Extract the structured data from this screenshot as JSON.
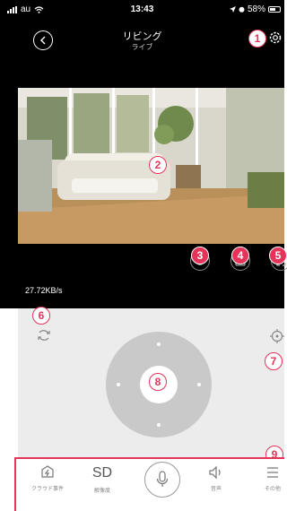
{
  "status_bar": {
    "carrier": "au",
    "time": "13:43",
    "battery": "58%"
  },
  "header": {
    "title": "リビング",
    "subtitle": "ライブ",
    "back_icon": "chevron-left-icon",
    "settings_icon": "gear-icon"
  },
  "video": {
    "data_rate": "27.72KB/s"
  },
  "video_controls": [
    {
      "icon": "replay-icon",
      "badge": "3"
    },
    {
      "icon": "camera-icon",
      "badge": "4"
    },
    {
      "icon": "fullscreen-icon",
      "badge": "5"
    }
  ],
  "control_panel": {
    "switch_icon": "switch-camera-icon",
    "locate_icon": "crosshair-icon"
  },
  "annotations": {
    "settings": "1",
    "video": "2",
    "replay": "3",
    "snapshot": "4",
    "fullscreen": "5",
    "switch": "6",
    "locate": "7",
    "joystick": "8",
    "tabbar": "9"
  },
  "tabbar": {
    "cloud_label": "クラウド事件",
    "sd_text": "SD",
    "sd_label": "解像度",
    "sound_label": "音声",
    "more_label": "その他"
  },
  "colors": {
    "accent": "#e5335a",
    "header_bg": "#000000",
    "panel_bg": "#ececec",
    "joystick": "#c9c9c9"
  }
}
